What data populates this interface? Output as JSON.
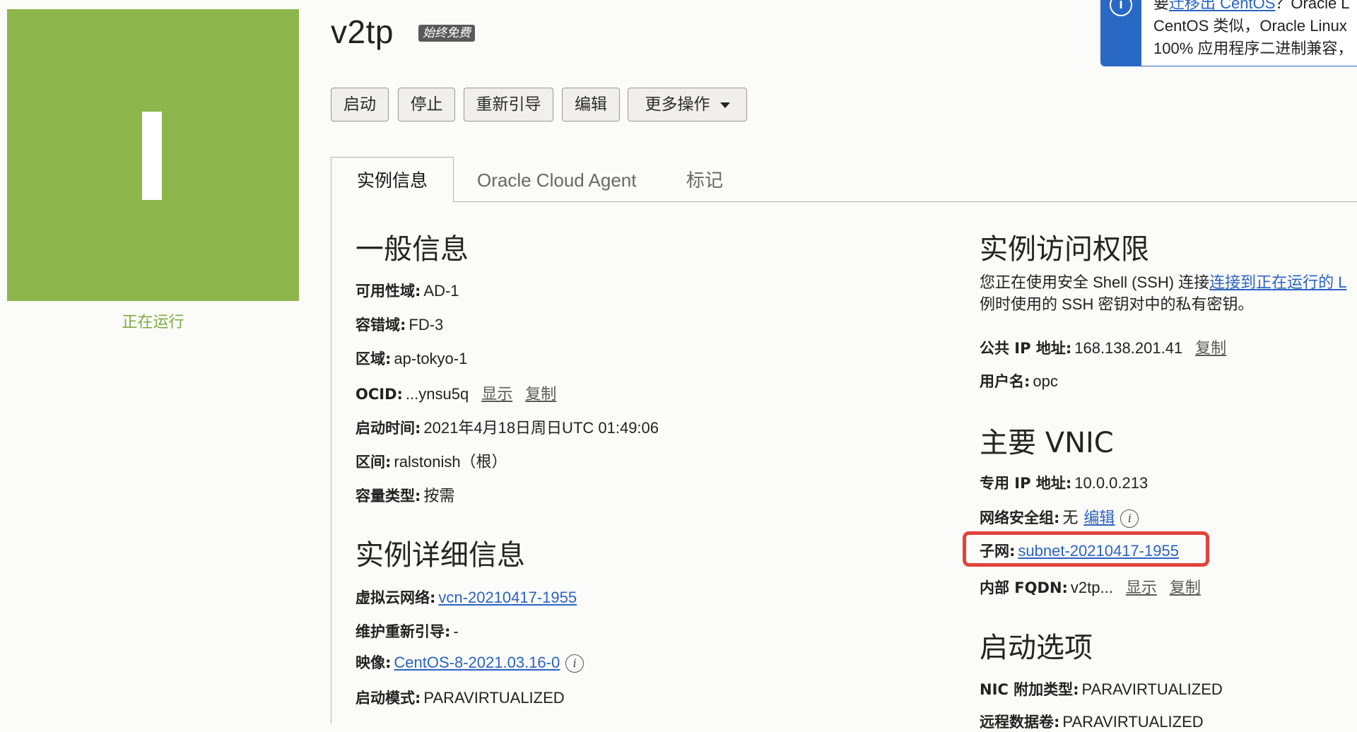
{
  "status": {
    "letter_icon": "instance-status-tile",
    "state": "正在运行",
    "color": "#8db64c"
  },
  "header": {
    "title": "v2tp",
    "badge": "始终免费"
  },
  "toolbar": {
    "start": "启动",
    "stop": "停止",
    "reboot": "重新引导",
    "edit": "编辑",
    "more": "更多操作"
  },
  "tabs": {
    "info": "实例信息",
    "agent": "Oracle Cloud Agent",
    "tags": "标记"
  },
  "banner": {
    "line1_prefix": "要",
    "line1_link": "迁移出 CentOS",
    "line1_suffix": "？Oracle L",
    "line2": "CentOS 类似，Oracle Linux",
    "line3": "100% 应用程序二进制兼容，"
  },
  "general": {
    "heading": "一般信息",
    "ad_label": "可用性域:",
    "ad_value": "AD-1",
    "fd_label": "容错域:",
    "fd_value": "FD-3",
    "region_label": "区域:",
    "region_value": "ap-tokyo-1",
    "ocid_label": "OCID:",
    "ocid_value": "...ynsu5q",
    "show": "显示",
    "copy": "复制",
    "launch_label": "启动时间:",
    "launch_value": "2021年4月18日周日UTC 01:49:06",
    "compartment_label": "区间:",
    "compartment_value": "ralstonish（根）",
    "capacity_label": "容量类型:",
    "capacity_value": "按需"
  },
  "details": {
    "heading": "实例详细信息",
    "vcn_label": "虚拟云网络:",
    "vcn_value": "vcn-20210417-1955",
    "maint_label": "维护重新引导:",
    "maint_value": "-",
    "image_label": "映像:",
    "image_value": "CentOS-8-2021.03.16-0",
    "launch_mode_label": "启动模式:",
    "launch_mode_value": "PARAVIRTUALIZED"
  },
  "access": {
    "heading": "实例访问权限",
    "text1_prefix": "您正在使用安全 Shell (SSH) 连接",
    "text1_link": "连接到正在运行的 L",
    "text2": "例时使用的 SSH 密钥对中的私有密钥。",
    "public_ip_label": "公共 IP 地址:",
    "public_ip_value": "168.138.201.41",
    "copy": "复制",
    "user_label": "用户名:",
    "user_value": "opc"
  },
  "vnic": {
    "heading": "主要 VNIC",
    "private_ip_label": "专用 IP 地址:",
    "private_ip_value": "10.0.0.213",
    "nsg_label": "网络安全组:",
    "nsg_value": "无",
    "nsg_edit": "编辑",
    "subnet_label": "子网:",
    "subnet_value": "subnet-20210417-1955",
    "fqdn_label": "内部 FQDN:",
    "fqdn_value": "v2tp...",
    "show": "显示",
    "copy": "复制"
  },
  "launch_options": {
    "heading": "启动选项",
    "nic_label": "NIC 附加类型:",
    "nic_value": "PARAVIRTUALIZED",
    "remote_label": "远程数据卷:",
    "remote_value": "PARAVIRTUALIZED"
  },
  "highlight_color": "#e2433a"
}
